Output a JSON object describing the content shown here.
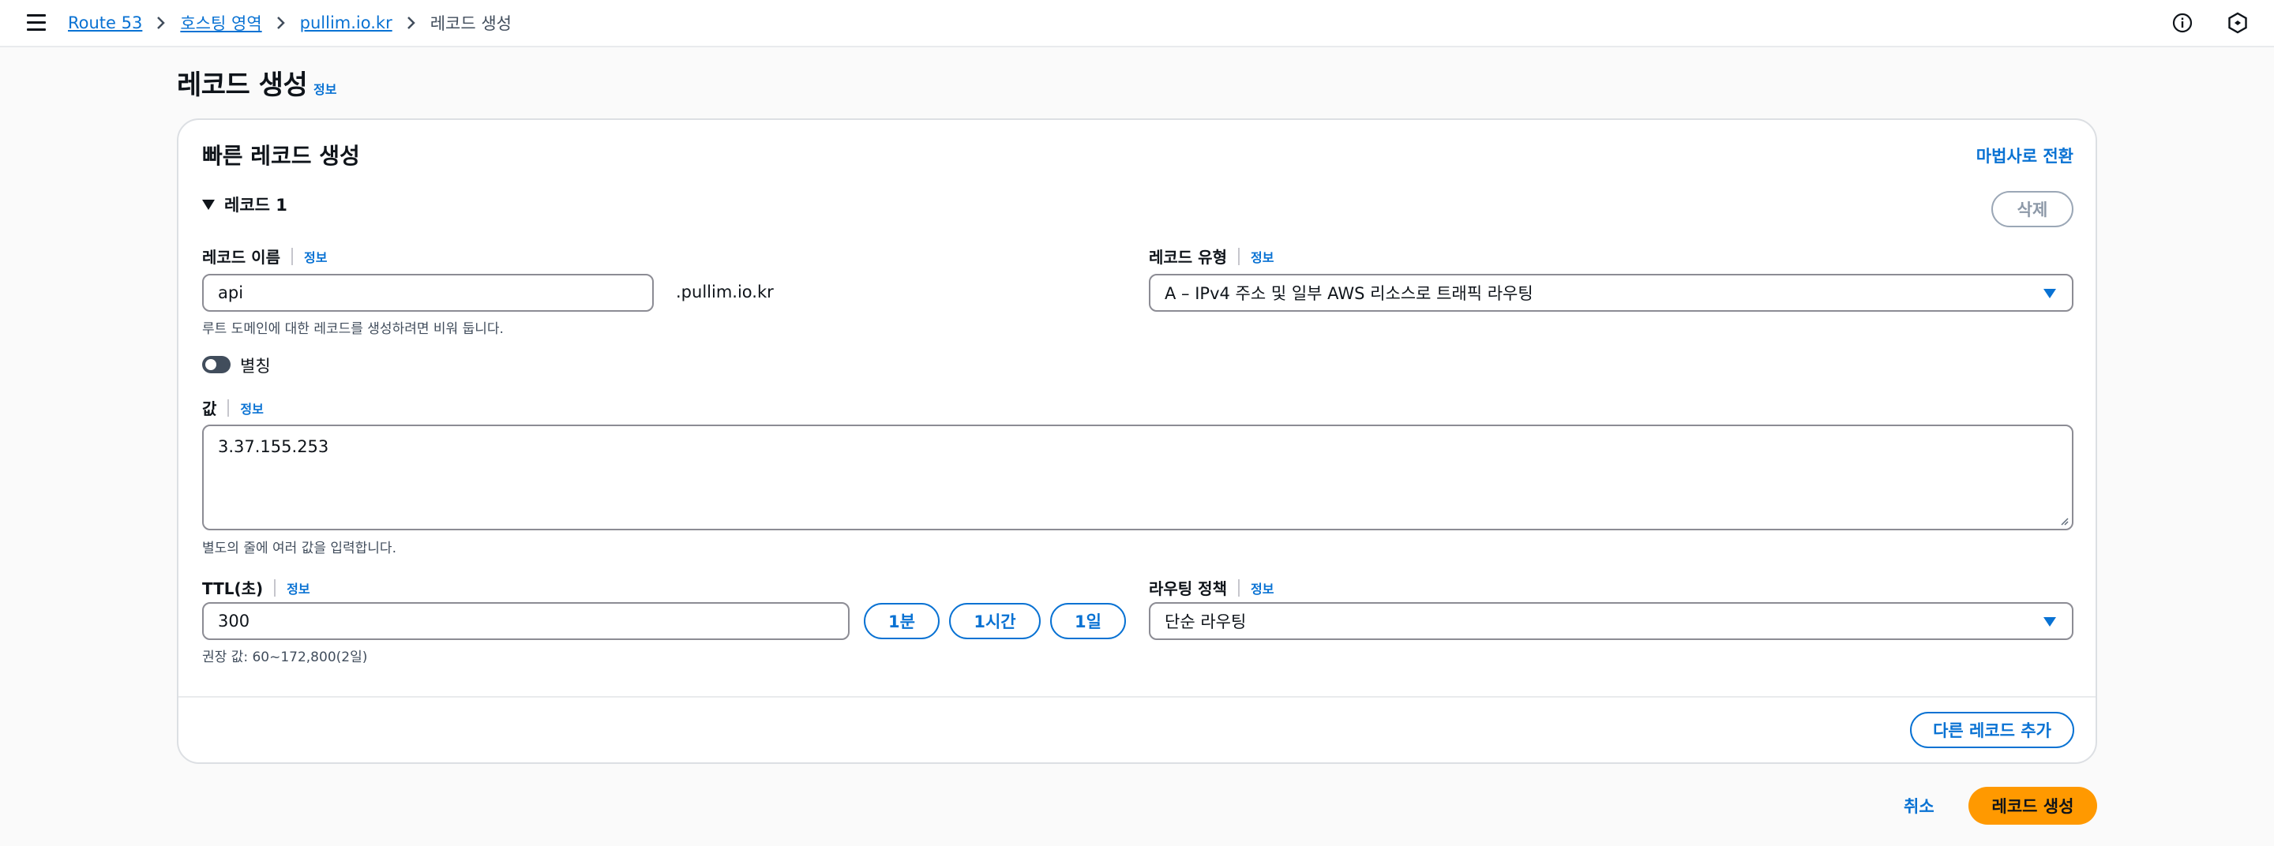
{
  "breadcrumb": {
    "items": [
      "Route 53",
      "호스팅 영역",
      "pullim.io.kr"
    ],
    "current": "레코드 생성"
  },
  "page": {
    "title": "레코드 생성",
    "info": "정보"
  },
  "card": {
    "title": "빠른 레코드 생성",
    "wizard_link": "마법사로 전환",
    "record_section": "레코드 1",
    "delete_label": "삭제",
    "record_name": {
      "label": "레코드 이름",
      "info": "정보",
      "value": "api",
      "domain_suffix": ".pullim.io.kr",
      "hint": "루트 도메인에 대한 레코드를 생성하려면 비워 둡니다."
    },
    "record_type": {
      "label": "레코드 유형",
      "info": "정보",
      "selected": "A – IPv4 주소 및 일부 AWS 리소스로 트래픽 라우팅"
    },
    "alias": {
      "label": "별칭",
      "enabled": false
    },
    "value": {
      "label": "값",
      "info": "정보",
      "text": "3.37.155.253",
      "hint": "별도의 줄에 여러 값을 입력합니다."
    },
    "ttl": {
      "label": "TTL(초)",
      "info": "정보",
      "value": "300",
      "hint": "권장 값: 60~172,800(2일)",
      "presets": [
        "1분",
        "1시간",
        "1일"
      ]
    },
    "routing_policy": {
      "label": "라우팅 정책",
      "info": "정보",
      "selected": "단순 라우팅"
    },
    "add_record_label": "다른 레코드 추가"
  },
  "footer": {
    "cancel": "취소",
    "create": "레코드 생성"
  },
  "colors": {
    "link": "#0972d3",
    "primary_button": "#ff9900",
    "border": "#8c8c94"
  },
  "icons": [
    "menu-icon",
    "chevron-right-icon",
    "info-circle-icon",
    "settings-hexagon-icon",
    "caret-down-icon"
  ]
}
